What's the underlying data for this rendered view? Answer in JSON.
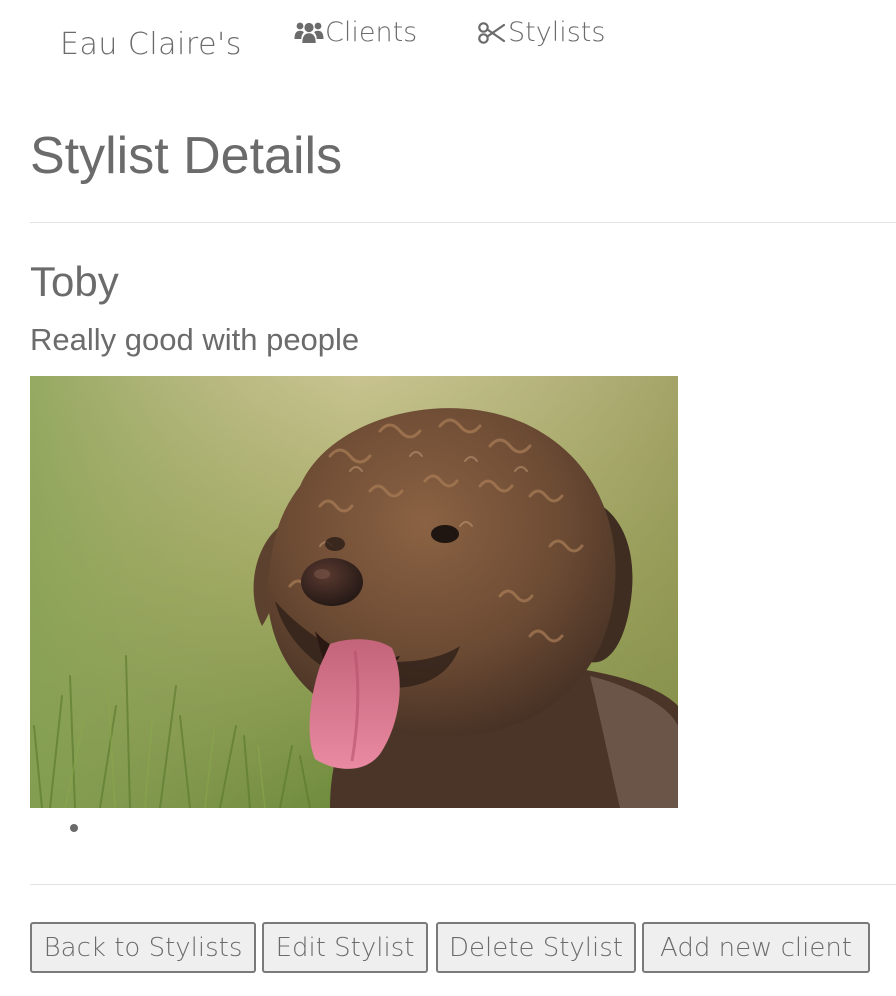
{
  "nav": {
    "brand": "Eau Claire's",
    "links": [
      {
        "label": "Clients",
        "icon": "users-icon"
      },
      {
        "label": "Stylists",
        "icon": "scissors-icon"
      }
    ]
  },
  "page": {
    "title": "Stylist Details"
  },
  "stylist": {
    "name": "Toby",
    "description": "Really good with people",
    "photo_subject": "curly-haired-dog-photo",
    "clients": [
      ""
    ]
  },
  "actions": {
    "back": "Back to Stylists",
    "edit": "Edit Stylist",
    "delete": "Delete Stylist",
    "add_client": "Add new client"
  },
  "colors": {
    "text": "#6b6b6b",
    "button_bg": "#efefef",
    "button_border": "#7a7a7a",
    "divider": "#e2e2e2"
  }
}
